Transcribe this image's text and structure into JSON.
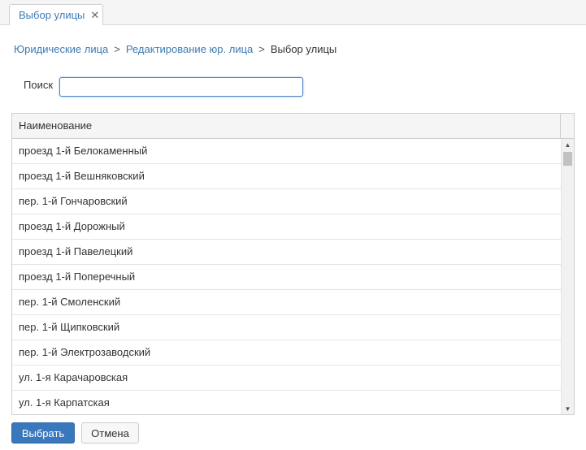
{
  "tab": {
    "label": "Выбор улицы",
    "close_glyph": "✕"
  },
  "breadcrumb": {
    "items": [
      "Юридические лица",
      "Редактирование юр. лица"
    ],
    "separator": ">",
    "current": "Выбор улицы"
  },
  "search": {
    "label": "Поиск",
    "value": "",
    "placeholder": ""
  },
  "grid": {
    "column_header": "Наименование",
    "rows": [
      "проезд 1-й Белокаменный",
      "проезд 1-й Вешняковский",
      "пер. 1-й Гончаровский",
      "проезд 1-й Дорожный",
      "проезд 1-й Павелецкий",
      "проезд 1-й Поперечный",
      "пер. 1-й Смоленский",
      "пер. 1-й Щипковский",
      "пер. 1-й Электрозаводский",
      "ул. 1-я Карачаровская",
      "ул. 1-я Карпатская"
    ],
    "scroll_up_icon": "▲",
    "scroll_down_icon": "▼"
  },
  "buttons": {
    "select": "Выбрать",
    "cancel": "Отмена"
  },
  "colors": {
    "accent": "#3a78bd",
    "link": "#3c79b4"
  }
}
